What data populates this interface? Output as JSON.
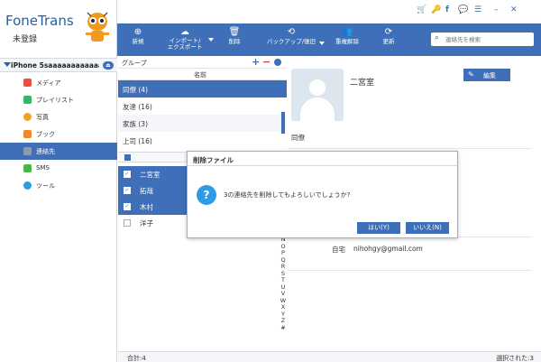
{
  "app": {
    "title": "FoneTrans",
    "subtitle": "未登録"
  },
  "device": {
    "name": "iPhone 5saaaaaaaaaaaaaa"
  },
  "sidebar": {
    "items": [
      {
        "label": "メディア",
        "icon": "music-icon",
        "color": "#e8513f"
      },
      {
        "label": "プレイリスト",
        "icon": "playlist-icon",
        "color": "#3ab36b"
      },
      {
        "label": "写真",
        "icon": "photo-icon",
        "color": "#f2a31e"
      },
      {
        "label": "ブック",
        "icon": "book-icon",
        "color": "#ef8a2b"
      },
      {
        "label": "連絡先",
        "icon": "contacts-icon",
        "color": "#8c9bb0"
      },
      {
        "label": "SMS",
        "icon": "sms-icon",
        "color": "#49b64b"
      },
      {
        "label": "ツール",
        "icon": "tools-icon",
        "color": "#2e9be6"
      }
    ]
  },
  "toolbar": {
    "new_label": "新規",
    "import_label": "インポート/\nエクスポート",
    "delete_label": "削除",
    "backup_label": "バックアップ/復旧",
    "dedupe_label": "重複解除",
    "refresh_label": "更新",
    "search_placeholder": "連絡先を検索"
  },
  "groups": {
    "header": "グループ",
    "column": "名前",
    "items": [
      {
        "label": "同僚 (4)",
        "selected": true
      },
      {
        "label": "友達 (16)",
        "selected": false
      },
      {
        "label": "家族 (3)",
        "selected": false
      },
      {
        "label": "上司 (16)",
        "selected": false
      }
    ]
  },
  "contacts": [
    {
      "name": "二宮室",
      "checked": true
    },
    {
      "name": "拓哉",
      "checked": true
    },
    {
      "name": "木村",
      "checked": true
    },
    {
      "name": "洋子",
      "checked": false
    }
  ],
  "alphabet": [
    "N",
    "O",
    "P",
    "Q",
    "R",
    "S",
    "T",
    "U",
    "V",
    "W",
    "X",
    "Y",
    "Z",
    "#"
  ],
  "detail": {
    "name": "二宮室",
    "edit_label": "編集",
    "group": "同僚",
    "home_label": "自宅",
    "home_value": "nihohgy@gmail.com"
  },
  "status": {
    "total": "合計:4",
    "selected": "選択された:3"
  },
  "dialog": {
    "title": "削除ファイル",
    "message": "3の連絡先を削除してもよろしいでしょうか?",
    "yes_label": "はい(Y)",
    "no_label": "いいえ(N)"
  }
}
